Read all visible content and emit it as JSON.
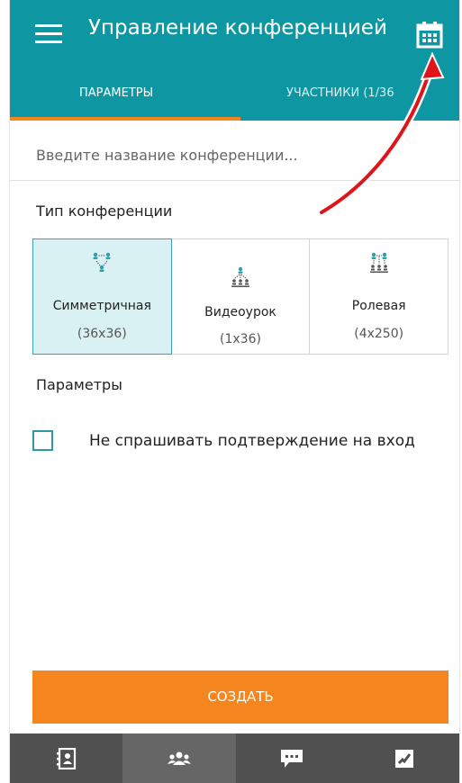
{
  "header": {
    "title": "Управление конференцией",
    "menu_icon": "hamburger-menu-icon",
    "calendar_icon": "calendar-icon"
  },
  "tabs": [
    {
      "label": "ПАРАМЕТРЫ",
      "active": true
    },
    {
      "label": "УЧАСТНИКИ (1/36",
      "active": false
    }
  ],
  "name_input": {
    "value": "",
    "placeholder": "Введите название конференции..."
  },
  "conference_type": {
    "label": "Тип конференции",
    "options": [
      {
        "name": "Симметричная",
        "size": "(36x36)",
        "icon": "symmetric-conference-icon",
        "selected": true
      },
      {
        "name": "Видеоурок",
        "size": "(1x36)",
        "icon": "video-lesson-icon",
        "selected": false
      },
      {
        "name": "Ролевая",
        "size": "(4x250)",
        "icon": "role-conference-icon",
        "selected": false
      }
    ]
  },
  "parameters": {
    "label": "Параметры",
    "skip_confirmation": {
      "label": "Не спрашивать подтверждение на вход",
      "checked": false
    }
  },
  "create_button": "СОЗДАТЬ",
  "bottom_nav": [
    {
      "icon": "contacts-icon",
      "active": false
    },
    {
      "icon": "group-conference-icon",
      "active": true
    },
    {
      "icon": "chat-icon",
      "active": false
    },
    {
      "icon": "call-icon",
      "active": false
    }
  ],
  "colors": {
    "header": "#0f96a3",
    "accent": "#f5861f",
    "selected_card": "#d9f1f3",
    "bottom_nav": "#505050",
    "annotation_arrow": "#e0151b"
  }
}
